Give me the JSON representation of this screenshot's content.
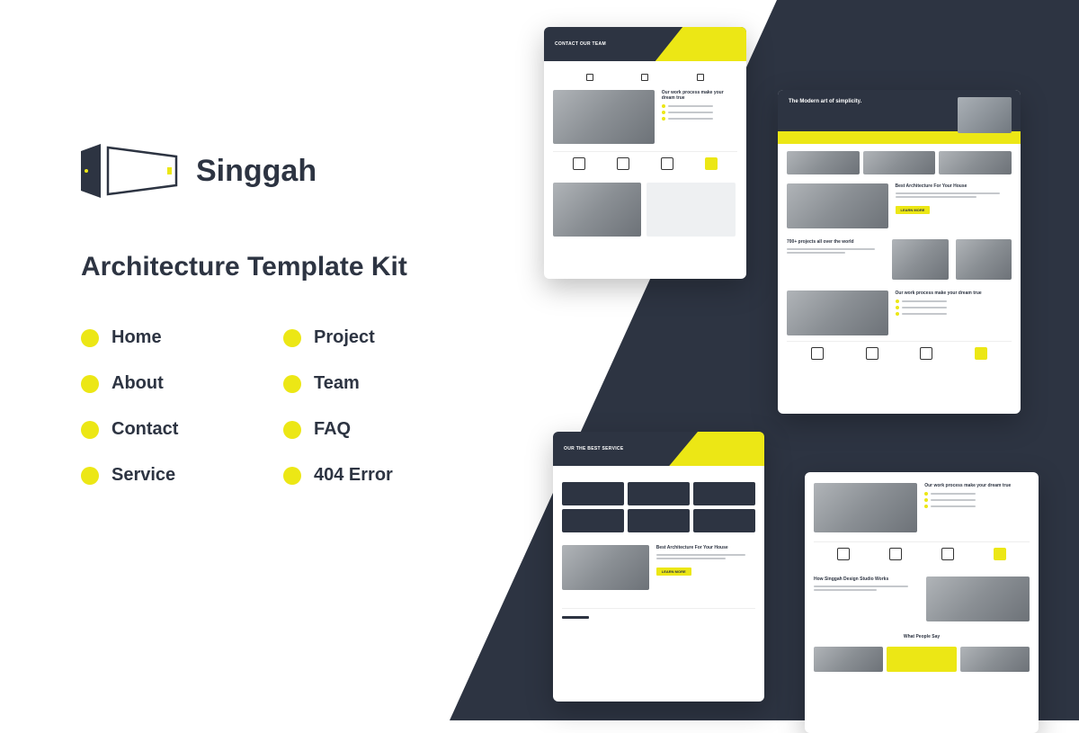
{
  "brand": {
    "name": "Singgah"
  },
  "tagline": "Architecture Template Kit",
  "pages": {
    "col1": [
      {
        "label": "Home"
      },
      {
        "label": "About"
      },
      {
        "label": "Contact"
      },
      {
        "label": "Service"
      }
    ],
    "col2": [
      {
        "label": "Project"
      },
      {
        "label": "Team"
      },
      {
        "label": "FAQ"
      },
      {
        "label": "404 Error"
      }
    ]
  },
  "mockups": {
    "m1": {
      "header": "CONTACT OUR TEAM",
      "section_title": "Our work process make your dream true"
    },
    "m2": {
      "hero_title": "The Modern art of simplicity.",
      "section1": "Best Architecture For Your House",
      "section2": "700+ projects all over the world",
      "section3": "Our work process make your dream true"
    },
    "m3": {
      "header": "OUR THE BEST SERVICE",
      "section_title": "Best Architecture For Your House"
    },
    "m4": {
      "section1": "Our work process make your dream true",
      "section2": "How Singgah Design Studio Works",
      "section3": "What People Say"
    }
  },
  "colors": {
    "accent": "#ece715",
    "dark": "#2d3442"
  }
}
